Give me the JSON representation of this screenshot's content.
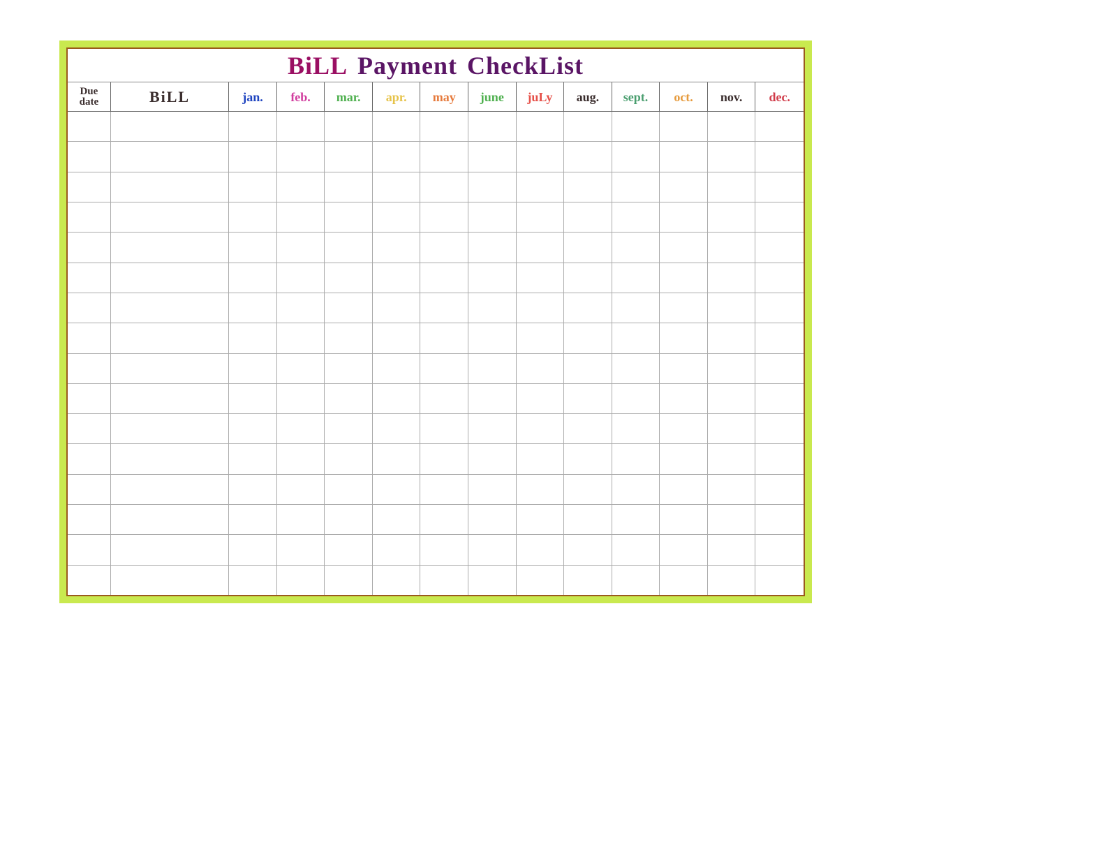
{
  "title": {
    "word1": "BiLL",
    "word2": "Payment",
    "word3": "CheckList"
  },
  "headers": {
    "due_date_line1": "Due",
    "due_date_line2": "date",
    "bill": "BiLL",
    "months": [
      "jan.",
      "feb.",
      "mar.",
      "apr.",
      "may",
      "june",
      "juLy",
      "aug.",
      "sept.",
      "oct.",
      "nov.",
      "dec."
    ]
  },
  "month_colors": [
    "#2045c0",
    "#d13c9e",
    "#4fb04f",
    "#e6c34a",
    "#e67a3c",
    "#4fb04f",
    "#e6514a",
    "#3b2e2e",
    "#4a9e6f",
    "#e69a3c",
    "#3b2e2e",
    "#d13c4a"
  ],
  "row_count": 16
}
